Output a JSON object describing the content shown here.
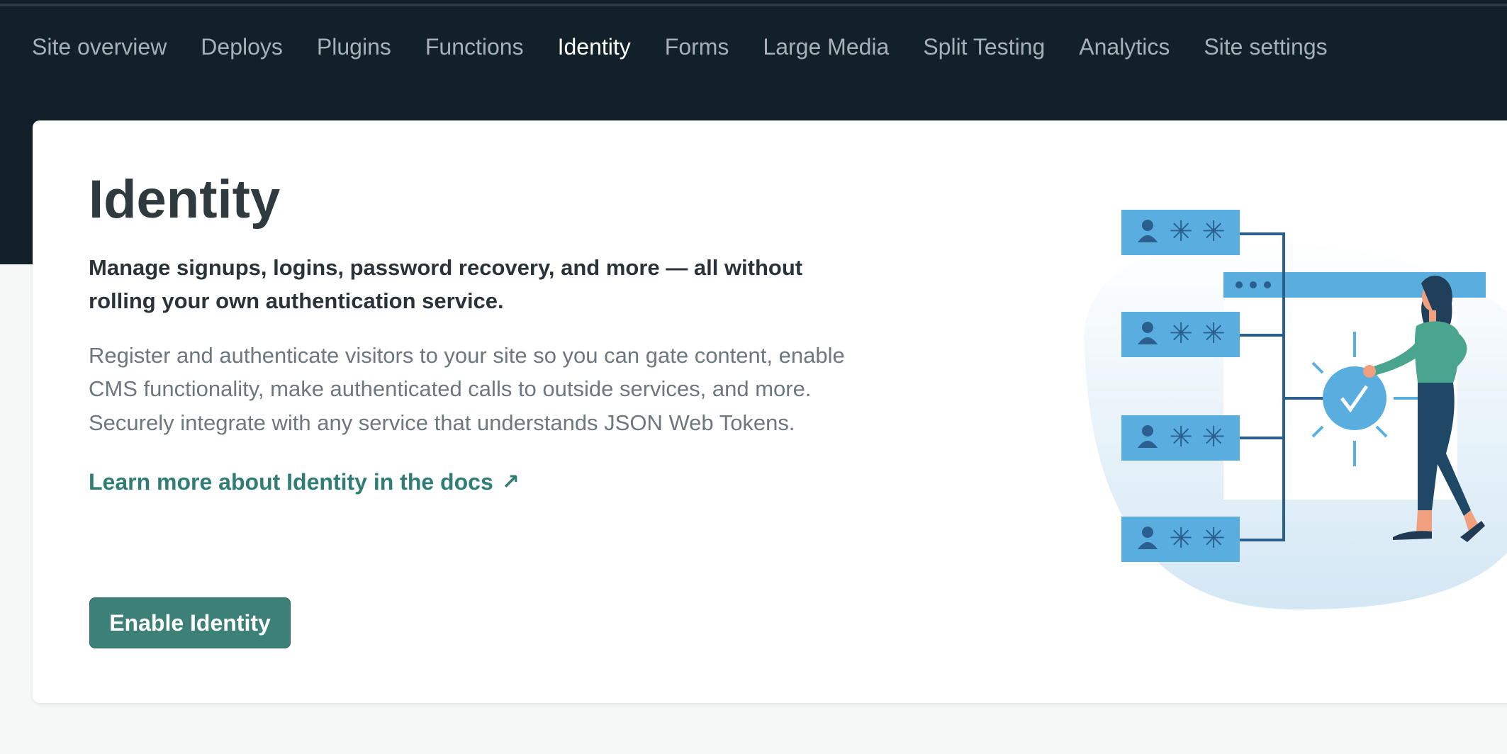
{
  "nav": {
    "items": [
      {
        "label": "Site overview",
        "active": false
      },
      {
        "label": "Deploys",
        "active": false
      },
      {
        "label": "Plugins",
        "active": false
      },
      {
        "label": "Functions",
        "active": false
      },
      {
        "label": "Identity",
        "active": true
      },
      {
        "label": "Forms",
        "active": false
      },
      {
        "label": "Large Media",
        "active": false
      },
      {
        "label": "Split Testing",
        "active": false
      },
      {
        "label": "Analytics",
        "active": false
      },
      {
        "label": "Site settings",
        "active": false
      }
    ]
  },
  "main": {
    "title": "Identity",
    "lead": "Manage signups, logins, password recovery, and more — all without rolling your own authentication service.",
    "description": "Register and authenticate visitors to your site so you can gate content, enable CMS functionality, make authenticated calls to outside services, and more. Securely integrate with any service that understands JSON Web Tokens.",
    "docs_link": "Learn more about Identity in the docs",
    "docs_link_icon": "arrow-up-right-icon",
    "enable_button": "Enable Identity"
  },
  "colors": {
    "topbar": "#12202a",
    "accent": "#3d8078",
    "link": "#2f7d74",
    "illustration_blue": "#5aaedf",
    "illustration_dark": "#2b5f8f"
  }
}
